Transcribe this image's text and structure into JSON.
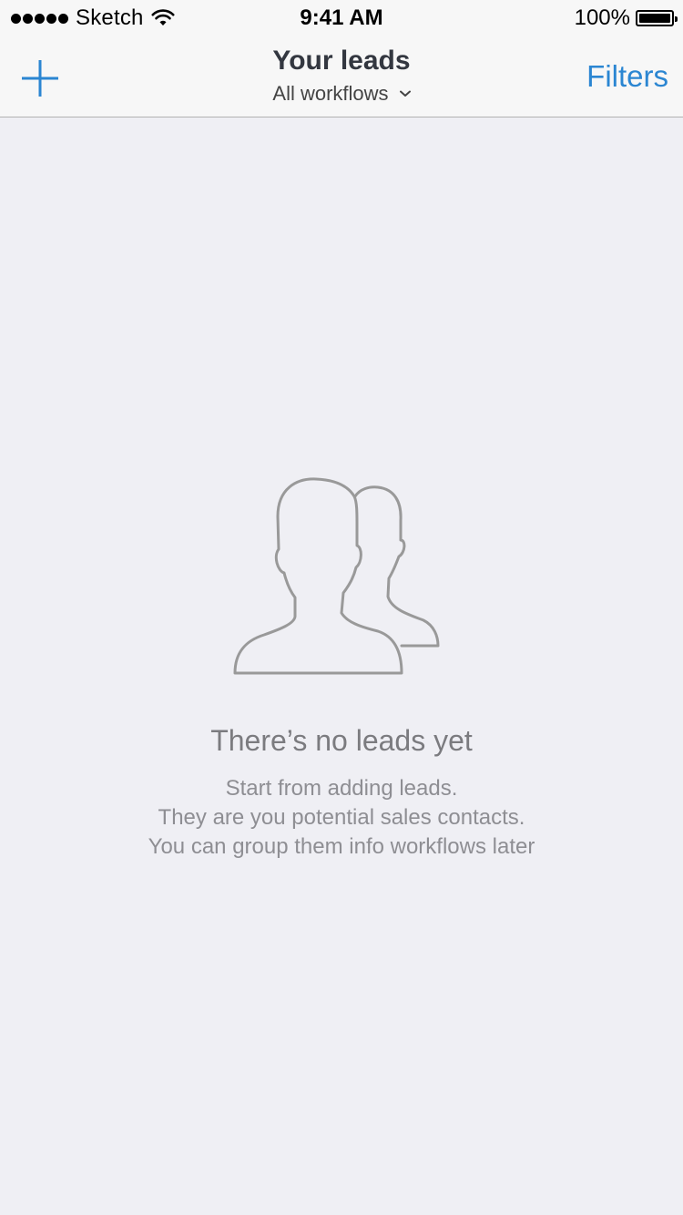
{
  "status_bar": {
    "carrier": "Sketch",
    "time": "9:41 AM",
    "battery": "100%"
  },
  "nav": {
    "title": "Your leads",
    "workflow_selector": "All workflows",
    "filters_label": "Filters",
    "add_icon": "plus-icon"
  },
  "empty_state": {
    "icon": "people-icon",
    "title": "There’s no leads yet",
    "description_lines": [
      "Start from adding leads.",
      "They are you potential sales contacts.",
      "You can group them info workflows later"
    ]
  },
  "colors": {
    "accent": "#2b86d2",
    "background": "#efeff4",
    "navbar": "#f7f7f7",
    "muted_text": "#8e8e93"
  }
}
